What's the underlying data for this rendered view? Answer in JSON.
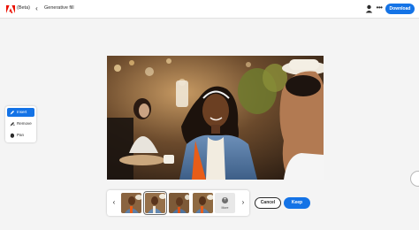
{
  "header": {
    "beta_label": "(Beta)",
    "title": "Generative fill",
    "back_icon": "chevron-left-icon",
    "more_label": "•••",
    "download_label": "Download"
  },
  "colors": {
    "accent": "#1473e6",
    "adobe_red": "#eb1000",
    "background": "#f4f4f4"
  },
  "tools": [
    {
      "label": "Insert",
      "icon": "insert-brush-icon",
      "active": true
    },
    {
      "label": "Remove",
      "icon": "remove-brush-icon",
      "active": false
    },
    {
      "label": "Pan",
      "icon": "hand-icon",
      "active": false
    }
  ],
  "variations": {
    "prev_icon": "chevron-left-icon",
    "next_icon": "chevron-right-icon",
    "more_label": "More",
    "selected_index": 1
  },
  "actions": {
    "cancel_label": "Cancel",
    "keep_label": "Keep"
  }
}
